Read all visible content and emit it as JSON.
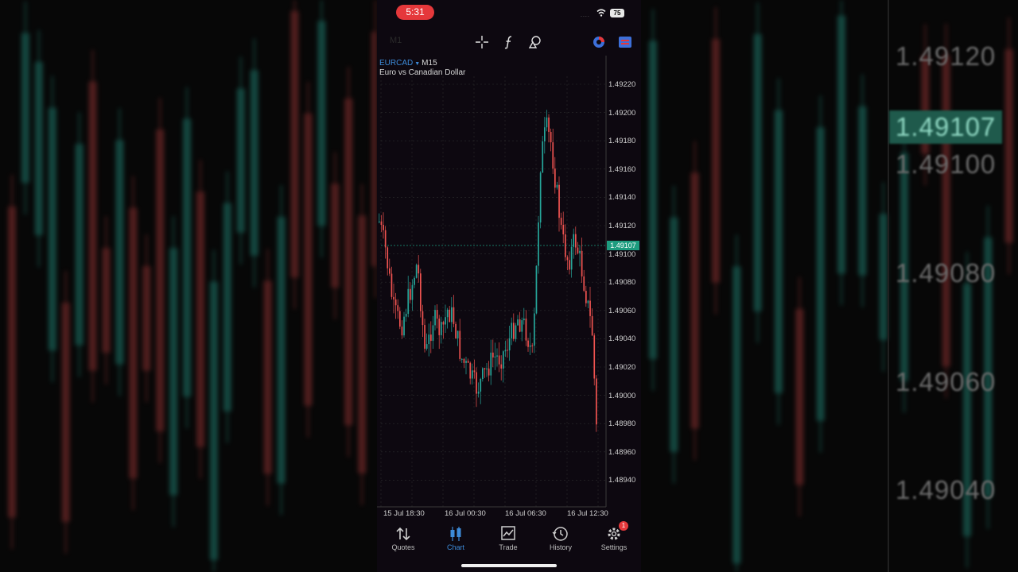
{
  "status_bar": {
    "time": "5:31",
    "signal": "....",
    "battery": "75"
  },
  "toolbar": {
    "timeframe_hint": "M1"
  },
  "chart": {
    "symbol": "EURCAD",
    "timeframe": "M15",
    "description": "Euro vs Canadian Dollar",
    "current_price": "1.49107",
    "price_labels": [
      "1.49220",
      "1.49200",
      "1.49180",
      "1.49160",
      "1.49140",
      "1.49120",
      "1.49100",
      "1.49080",
      "1.49060",
      "1.49040",
      "1.49020",
      "1.49000",
      "1.48980",
      "1.48960",
      "1.48940"
    ],
    "time_labels": [
      "15 Jul 18:30",
      "16 Jul 00:30",
      "16 Jul 06:30",
      "16 Jul 12:30"
    ],
    "colors": {
      "up": "#26a69a",
      "down": "#ef5350",
      "current": "#1d9c7f",
      "symbol": "#3d8bd9"
    }
  },
  "background": {
    "price_labels": [
      "1.49120",
      "1.49107",
      "1.49100",
      "1.49080",
      "1.49060",
      "1.49040"
    ]
  },
  "tabs": [
    {
      "label": "Quotes",
      "icon": "quotes-icon"
    },
    {
      "label": "Chart",
      "icon": "chart-icon"
    },
    {
      "label": "Trade",
      "icon": "trade-icon"
    },
    {
      "label": "History",
      "icon": "history-icon"
    },
    {
      "label": "Settings",
      "icon": "settings-icon",
      "badge": "1"
    }
  ]
}
